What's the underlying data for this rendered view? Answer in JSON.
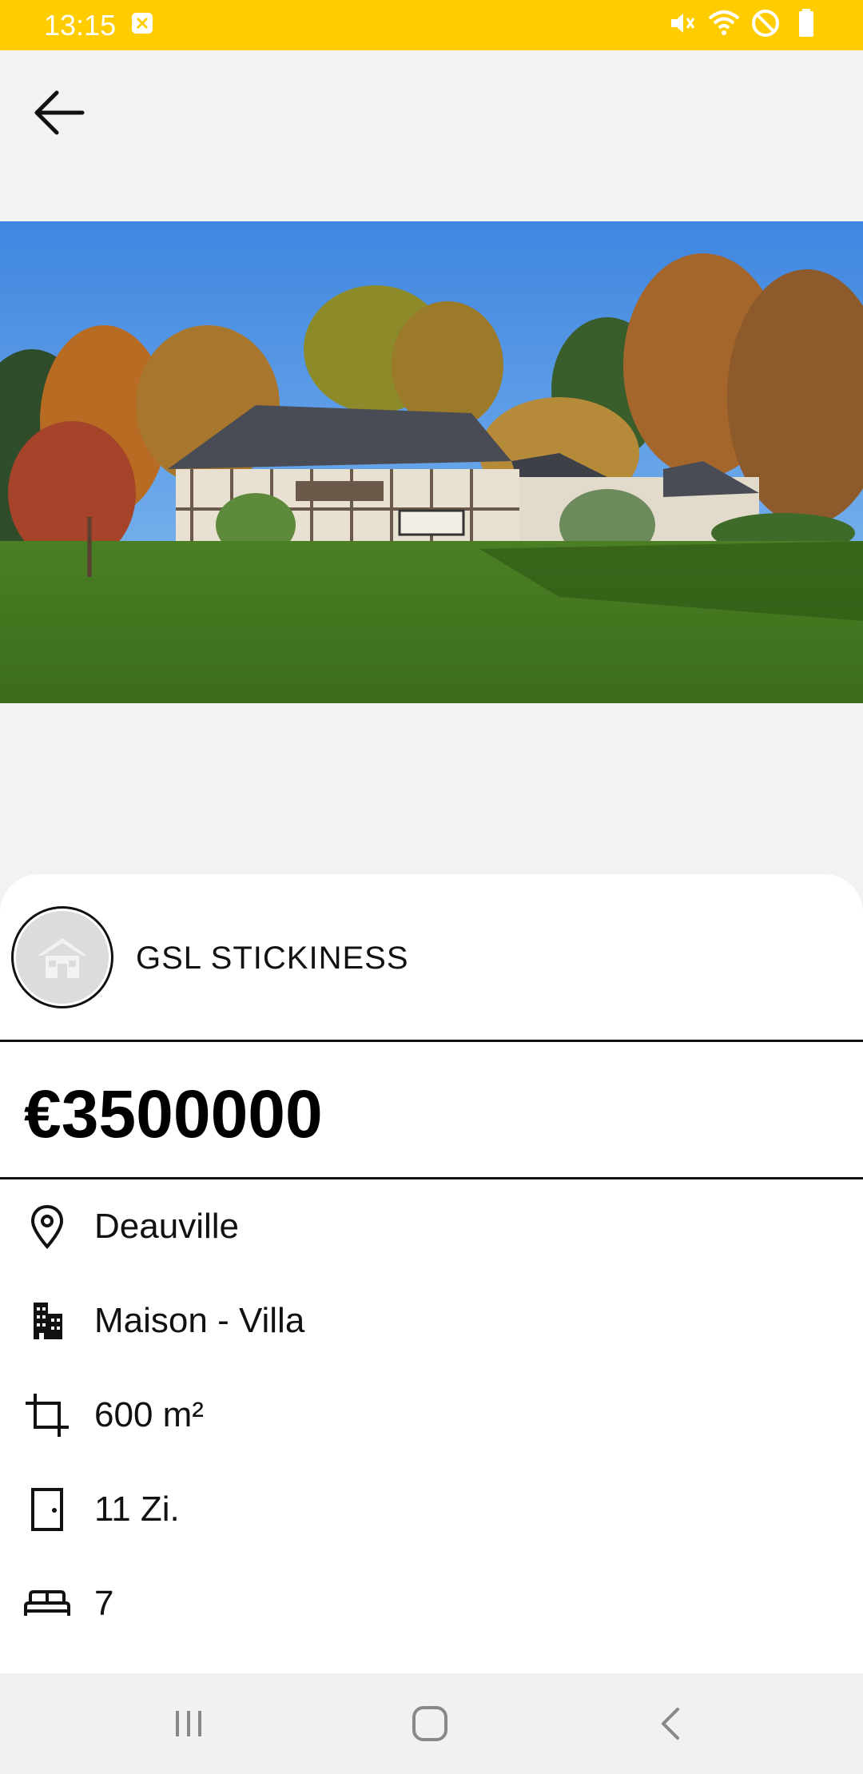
{
  "status_bar": {
    "time": "13:15",
    "background": "#ffcc00",
    "icons": [
      "notification-icon",
      "mute-icon",
      "wifi-icon",
      "no-disturb-icon",
      "battery-icon"
    ]
  },
  "app_bar": {
    "back_icon": "arrow-left-icon"
  },
  "hero": {
    "image": "property-photo"
  },
  "listing": {
    "agency_name": "GSL STICKINESS",
    "agency_avatar_icon": "house-icon",
    "price": "€3500000",
    "details": [
      {
        "icon": "location-pin-icon",
        "text": "Deauville"
      },
      {
        "icon": "building-icon",
        "text": "Maison - Villa"
      },
      {
        "icon": "crop-icon",
        "text": "600 m²"
      },
      {
        "icon": "door-icon",
        "text": "11 Zi."
      },
      {
        "icon": "bed-icon",
        "text": "7"
      }
    ]
  },
  "nav_bar": {
    "buttons": [
      "recent-apps-icon",
      "home-icon",
      "back-icon"
    ]
  }
}
